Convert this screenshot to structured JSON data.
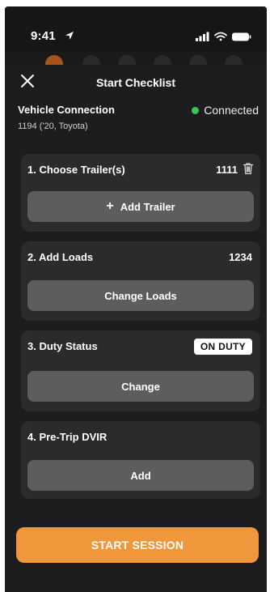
{
  "status_bar": {
    "time": "9:41",
    "icons": [
      "location-arrow-icon",
      "signal-icon",
      "wifi-icon",
      "battery-icon"
    ]
  },
  "header": {
    "title": "Start Checklist",
    "close_icon": "close-icon"
  },
  "vehicle": {
    "label": "Vehicle Connection",
    "detail": "1194 ('20, Toyota)",
    "status": "Connected",
    "status_color": "#34c759"
  },
  "steps": [
    {
      "title": "1. Choose Trailer(s)",
      "value": "1111",
      "button_label": "Add Trailer",
      "button_icon": "plus-icon"
    },
    {
      "title": "2. Add Loads",
      "value": "1234",
      "button_label": "Change Loads"
    },
    {
      "title": "3. Duty Status",
      "badge": "ON DUTY",
      "button_label": "Change"
    },
    {
      "title": "4. Pre-Trip DVIR",
      "button_label": "Add"
    }
  ],
  "start_button": {
    "label": "START SESSION",
    "color": "#f0963b"
  }
}
